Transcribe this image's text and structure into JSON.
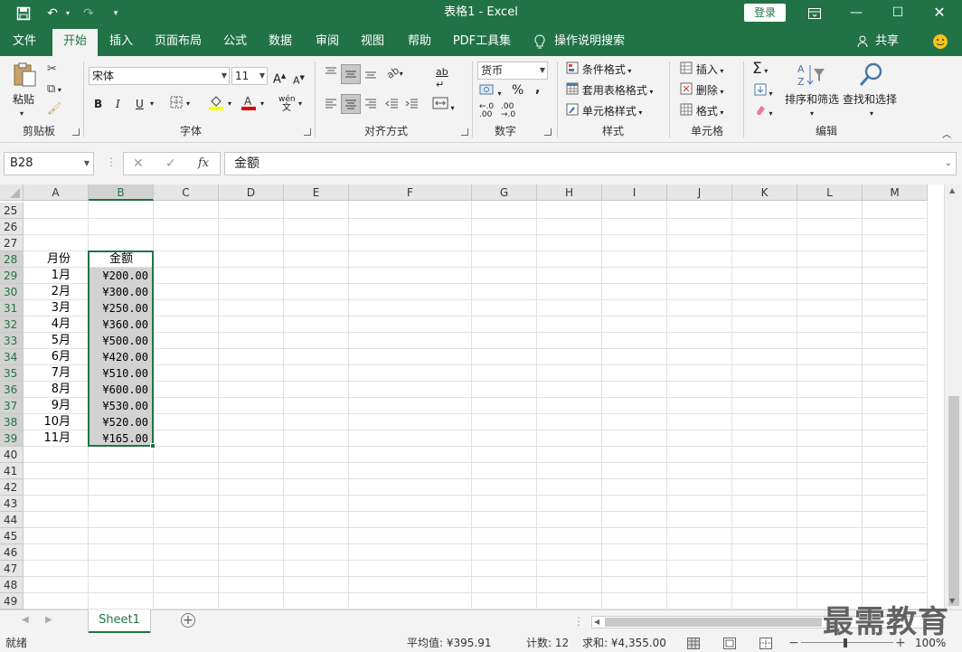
{
  "window": {
    "title": "表格1  -  Excel",
    "login_label": "登录",
    "save_icon": "save-icon",
    "undo_icon": "undo-icon",
    "redo_icon": "redo-icon",
    "customize_icon": "customize-quick-access-icon"
  },
  "tabs": [
    {
      "label": "文件"
    },
    {
      "label": "开始",
      "active": true
    },
    {
      "label": "插入"
    },
    {
      "label": "页面布局"
    },
    {
      "label": "公式"
    },
    {
      "label": "数据"
    },
    {
      "label": "审阅"
    },
    {
      "label": "视图"
    },
    {
      "label": "帮助"
    },
    {
      "label": "PDF工具集"
    },
    {
      "label": "操作说明搜索"
    }
  ],
  "share_label": "共享",
  "ribbon": {
    "clipboard": {
      "paste_label": "粘贴",
      "group_label": "剪贴板"
    },
    "font": {
      "font_name": "宋体",
      "font_size": "11",
      "group_label": "字体",
      "bold": "B",
      "italic": "I",
      "underline": "U",
      "phonetic": "wén"
    },
    "alignment": {
      "group_label": "对齐方式",
      "wrap": "ab"
    },
    "number": {
      "format": "货币",
      "percent": "%",
      "comma": ",",
      "group_label": "数字"
    },
    "styles": {
      "conditional": "条件格式",
      "table": "套用表格格式",
      "cell_styles": "单元格样式",
      "group_label": "样式"
    },
    "cells": {
      "insert": "插入",
      "delete": "删除",
      "format": "格式",
      "group_label": "单元格"
    },
    "editing": {
      "sort_filter": "排序和筛选",
      "find_select": "查找和选择",
      "group_label": "编辑"
    }
  },
  "formula_bar": {
    "name_box": "B28",
    "fx": "fx",
    "content": "金额"
  },
  "columns": [
    "A",
    "B",
    "C",
    "D",
    "E",
    "F",
    "G",
    "H",
    "I",
    "J",
    "K",
    "L",
    "M"
  ],
  "selected_column": "B",
  "row_numbers": [
    "25",
    "26",
    "27",
    "28",
    "29",
    "30",
    "31",
    "32",
    "33",
    "34",
    "35",
    "36",
    "37",
    "38",
    "39",
    "40",
    "41",
    "42",
    "43",
    "44",
    "45",
    "46",
    "47",
    "48",
    "49"
  ],
  "sheet_rows": [
    {
      "row": "28",
      "a": "月份",
      "b": "金额"
    },
    {
      "row": "29",
      "a": "1月",
      "b": "¥200.00"
    },
    {
      "row": "30",
      "a": "2月",
      "b": "¥300.00"
    },
    {
      "row": "31",
      "a": "3月",
      "b": "¥250.00"
    },
    {
      "row": "32",
      "a": "4月",
      "b": "¥360.00"
    },
    {
      "row": "33",
      "a": "5月",
      "b": "¥500.00"
    },
    {
      "row": "34",
      "a": "6月",
      "b": "¥420.00"
    },
    {
      "row": "35",
      "a": "7月",
      "b": "¥510.00"
    },
    {
      "row": "36",
      "a": "8月",
      "b": "¥600.00"
    },
    {
      "row": "37",
      "a": "9月",
      "b": "¥530.00"
    },
    {
      "row": "38",
      "a": "10月",
      "b": "¥520.00"
    },
    {
      "row": "39",
      "a": "11月",
      "b": "¥165.00"
    }
  ],
  "sheet_tabs": [
    {
      "label": "Sheet1"
    }
  ],
  "status": {
    "ready": "就绪",
    "average": "平均值: ¥395.91",
    "count": "计数: 12",
    "sum": "求和: ¥4,355.00",
    "zoom": "100%"
  },
  "watermark": "最需教育",
  "colors": {
    "accent": "#217346",
    "selection_fill": "#d2d2d2"
  }
}
